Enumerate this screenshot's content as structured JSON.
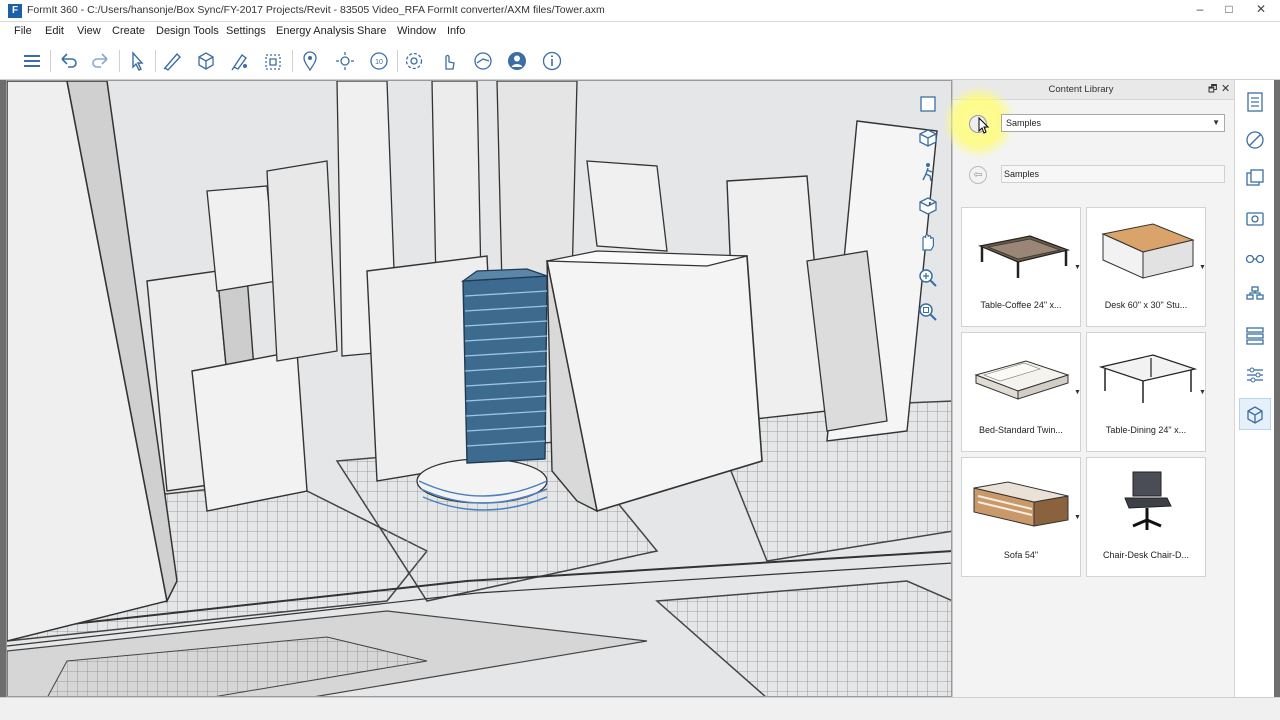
{
  "window": {
    "title": "FormIt 360 - C:/Users/hansonje/Box Sync/FY-2017 Projects/Revit - 83505 Video_RFA FormIt converter/AXM files/Tower.axm",
    "logo_letter": "F",
    "minimize": "–",
    "maximize": "□",
    "close": "✕"
  },
  "menu": [
    "File",
    "Edit",
    "View",
    "Create",
    "Design Tools",
    "Settings",
    "Energy Analysis",
    "Share",
    "Window",
    "Info"
  ],
  "toolbar_icons": [
    "layers-icon",
    "undo-icon",
    "redo-icon",
    "select-icon",
    "sketch-icon",
    "add-solid-icon",
    "paint-icon",
    "group-icon",
    "location-icon",
    "sun-icon",
    "level-icon",
    "settings-icon",
    "touch-icon",
    "share-icon",
    "user-icon",
    "info-icon"
  ],
  "content_library": {
    "title": "Content Library",
    "pin": "🗗",
    "close": "✕",
    "source_selected": "Samples",
    "path": "Samples",
    "path_back": "⇦",
    "items": [
      {
        "label": "Table-Coffee 24\" x..."
      },
      {
        "label": "Desk 60\" x 30\" Stu..."
      },
      {
        "label": "Bed-Standard Twin..."
      },
      {
        "label": "Table-Dining 24\" x..."
      },
      {
        "label": "Sofa 54\""
      },
      {
        "label": "Chair-Desk Chair-D..."
      }
    ]
  },
  "colors": {
    "accent": "#1a5fa8",
    "tower_glass": "#3d6b8f",
    "highlight": "#fffc96"
  }
}
